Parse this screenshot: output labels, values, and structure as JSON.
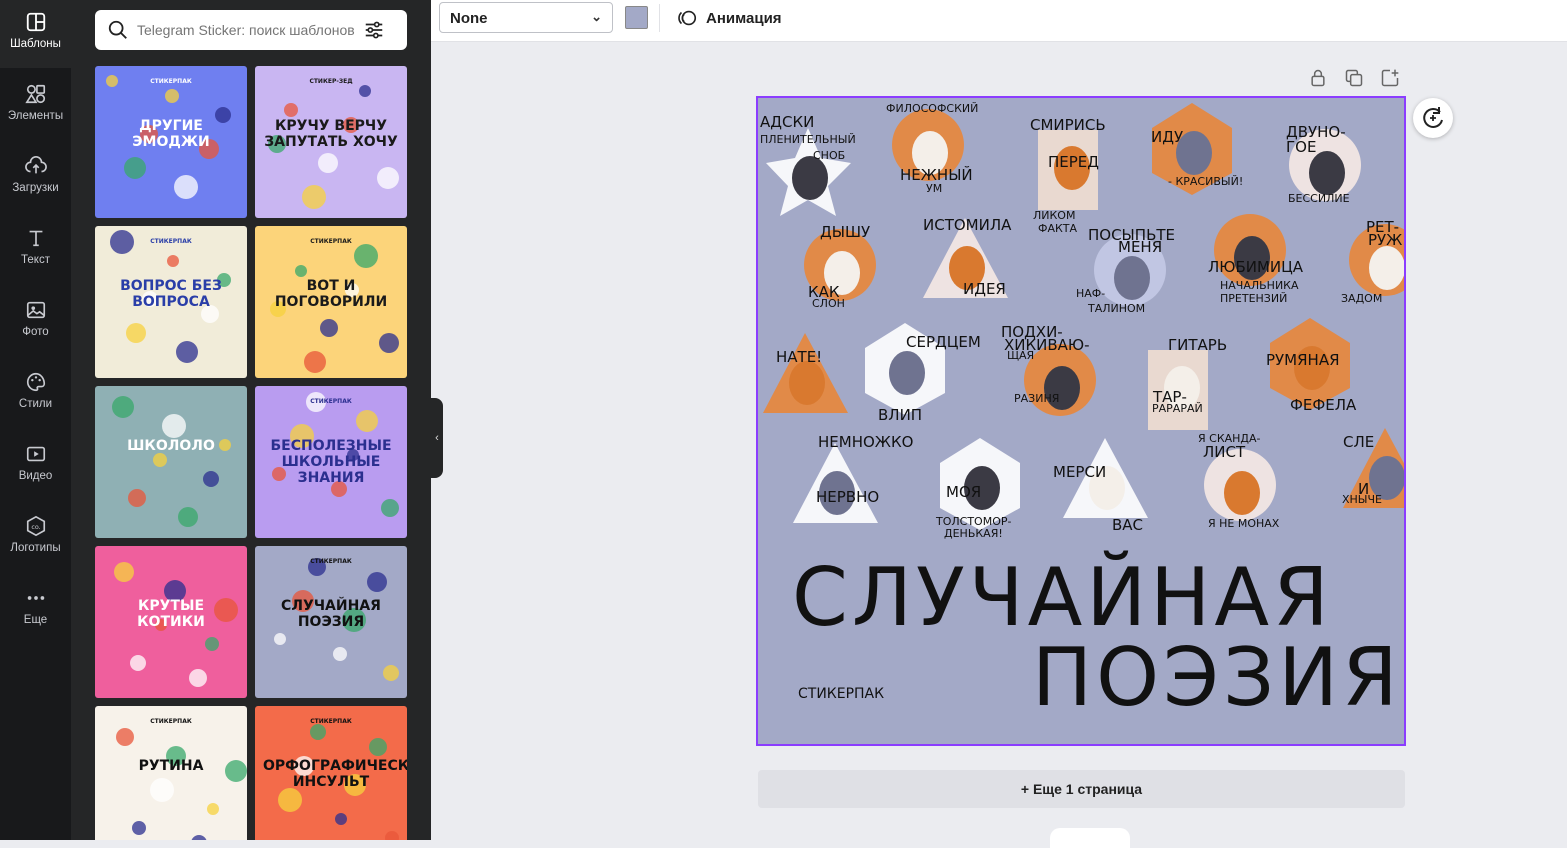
{
  "nav": {
    "items": [
      {
        "label": "Шаблоны",
        "icon": "templates-icon"
      },
      {
        "label": "Элементы",
        "icon": "elements-icon"
      },
      {
        "label": "Загрузки",
        "icon": "upload-icon"
      },
      {
        "label": "Текст",
        "icon": "text-icon"
      },
      {
        "label": "Фото",
        "icon": "photo-icon"
      },
      {
        "label": "Стили",
        "icon": "styles-icon"
      },
      {
        "label": "Видео",
        "icon": "video-icon"
      },
      {
        "label": "Логотипы",
        "icon": "logo-icon"
      },
      {
        "label": "Еще",
        "icon": "more-icon"
      }
    ]
  },
  "panel": {
    "search_placeholder": "Telegram Sticker: поиск шаблонов",
    "templates": [
      {
        "title": "ДРУГИЕ ЭМОДЖИ",
        "brand": "СТИКЕРПАК",
        "bg": "#6f7ff0",
        "fg": "#ffffff"
      },
      {
        "title": "КРУЧУ ВЕРЧУ ЗАПУТАТЬ ХОЧУ",
        "brand": "СТИКЕР-ЗЕД",
        "bg": "#c9b6f2",
        "fg": "#1a1a1a"
      },
      {
        "title": "ВОПРОС БЕЗ ВОПРОСА",
        "brand": "СТИКЕРПАК",
        "bg": "#f1ecd9",
        "fg": "#2a3ea8"
      },
      {
        "title": "ВОТ И ПОГОВОРИЛИ",
        "brand": "СТИКЕРПАК",
        "bg": "#fcd47a",
        "fg": "#1a1a1a"
      },
      {
        "title": "ШКОЛОЛО",
        "brand": "",
        "bg": "#8fb0b4",
        "fg": "#ffffff"
      },
      {
        "title": "БЕСПОЛЕЗНЫЕ ШКОЛЬНЫЕ ЗНАНИЯ",
        "brand": "СТИКЕРПАК",
        "bg": "#b99cf0",
        "fg": "#2b2f8f"
      },
      {
        "title": "КРУТЫЕ КОТИКИ",
        "brand": "",
        "bg": "#ef5f9d",
        "fg": "#ffffff"
      },
      {
        "title": "СЛУЧАЙНАЯ ПОЭЗИЯ",
        "brand": "СТИКЕРПАК",
        "bg": "#a3a9c7",
        "fg": "#111111"
      },
      {
        "title": "РУТИНА",
        "brand": "СТИКЕРПАК",
        "bg": "#f7f2ea",
        "fg": "#111111"
      },
      {
        "title": "ОРФОГРАФИЧЕСКИЙ ИНСУЛЬТ",
        "brand": "СТИКЕРПАК",
        "bg": "#f36b4a",
        "fg": "#111111"
      }
    ]
  },
  "toolbar": {
    "font_value": "None",
    "text_color": "#a3a9c7",
    "animation_label": "Анимация"
  },
  "design": {
    "bg_color": "#a3a9c7",
    "title_line1": "СЛУЧАЙНАЯ",
    "title_line2": "ПОЭЗИЯ",
    "brand": "СТИКЕРПАК",
    "stickers": [
      {
        "words": [
          "АДСКИ",
          "ПЛЕНИТЕЛЬНЫЙ",
          "СНОБ"
        ]
      },
      {
        "words": [
          "ФИЛОСОФСКИЙ",
          "НЕЖНЫЙ",
          "УМ"
        ]
      },
      {
        "words": [
          "СМИРИСЬ",
          "ПЕРЕД",
          "ЛИКОМ",
          "ФАКТА"
        ]
      },
      {
        "words": [
          "ИДУ",
          "- КРАСИВЫЙ!"
        ]
      },
      {
        "words": [
          "ДВУНО-",
          "ГОЕ",
          "БЕССИЛИЕ"
        ]
      },
      {
        "words": [
          "ДЫШУ",
          "КАК",
          "СЛОН"
        ]
      },
      {
        "words": [
          "ИСТОМИЛА",
          "ИДЕЯ"
        ]
      },
      {
        "words": [
          "ПОСЫПЬТЕ",
          "МЕНЯ",
          "НАФ-",
          "ТАЛИНОМ"
        ]
      },
      {
        "words": [
          "ЛЮБИМИЦА",
          "НАЧАЛЬНИКА",
          "ПРЕТЕНЗИЙ"
        ]
      },
      {
        "words": [
          "РЕТ-",
          "РУЖ",
          "ЗАДОМ"
        ]
      },
      {
        "words": [
          "НАТЕ!"
        ]
      },
      {
        "words": [
          "СЕРДЦЕМ",
          "ВЛИП"
        ]
      },
      {
        "words": [
          "ПОДХИ-",
          "ХИКИВАЮ-",
          "ЩАЯ",
          "РАЗИНЯ"
        ]
      },
      {
        "words": [
          "ГИТАРЬ",
          "ТАР-",
          "РАРАРАЙ"
        ]
      },
      {
        "words": [
          "РУМЯНАЯ",
          "ФЕФЕЛА"
        ]
      },
      {
        "words": [
          "НЕМНОЖКО",
          "НЕРВНО"
        ]
      },
      {
        "words": [
          "МОЯ",
          "ТОЛСТОМОР-",
          "ДЕНЬКАЯ!"
        ]
      },
      {
        "words": [
          "МЕРСИ",
          "ВАС"
        ]
      },
      {
        "words": [
          "Я СКАНДА-",
          "ЛИСТ",
          "Я НЕ МОНАХ"
        ]
      },
      {
        "words": [
          "СЛЕ",
          "И",
          "ХНЫЧЕ"
        ]
      }
    ]
  },
  "add_page_label": "+ Еще 1 страница"
}
